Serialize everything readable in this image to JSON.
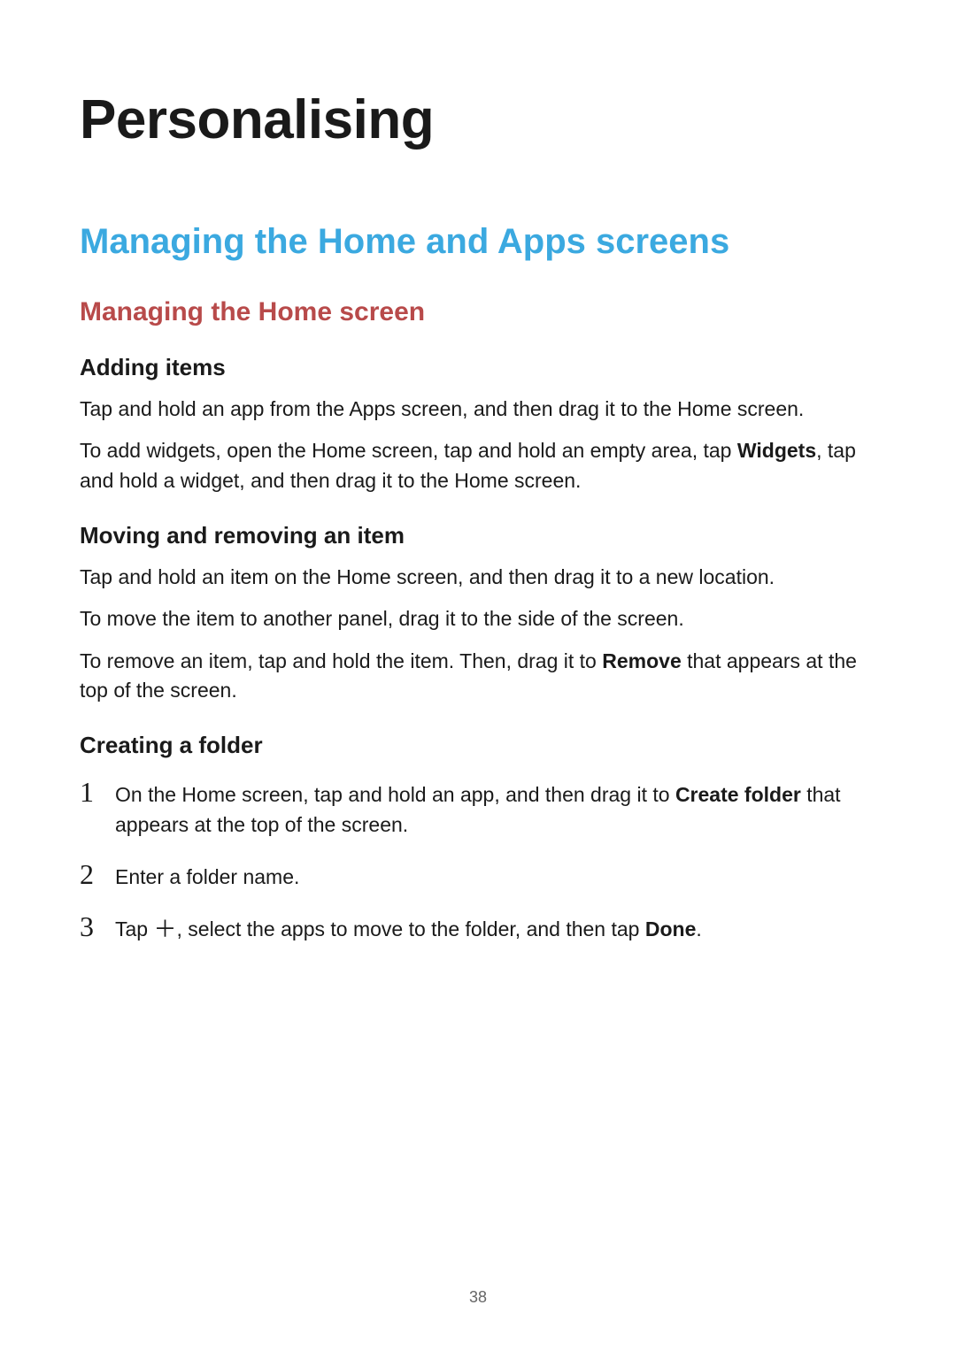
{
  "page": {
    "title": "Personalising",
    "section_heading": "Managing the Home and Apps screens",
    "subsection_heading": "Managing the Home screen",
    "page_number": "38"
  },
  "topics": {
    "adding_items": {
      "heading": "Adding items",
      "p1": "Tap and hold an app from the Apps screen, and then drag it to the Home screen.",
      "p2_pre": "To add widgets, open the Home screen, tap and hold an empty area, tap ",
      "p2_bold": "Widgets",
      "p2_post": ", tap and hold a widget, and then drag it to the Home screen."
    },
    "moving_removing": {
      "heading": "Moving and removing an item",
      "p1": "Tap and hold an item on the Home screen, and then drag it to a new location.",
      "p2": "To move the item to another panel, drag it to the side of the screen.",
      "p3_pre": "To remove an item, tap and hold the item. Then, drag it to ",
      "p3_bold": "Remove",
      "p3_post": " that appears at the top of the screen."
    },
    "creating_folder": {
      "heading": "Creating a folder",
      "steps": {
        "num1": "1",
        "step1_pre": "On the Home screen, tap and hold an app, and then drag it to ",
        "step1_bold": "Create folder",
        "step1_post": " that appears at the top of the screen.",
        "num2": "2",
        "step2": "Enter a folder name.",
        "num3": "3",
        "step3_pre": "Tap ",
        "step3_icon": "＋",
        "step3_mid": ", select the apps to move to the folder, and then tap ",
        "step3_bold": "Done",
        "step3_post": "."
      }
    }
  }
}
